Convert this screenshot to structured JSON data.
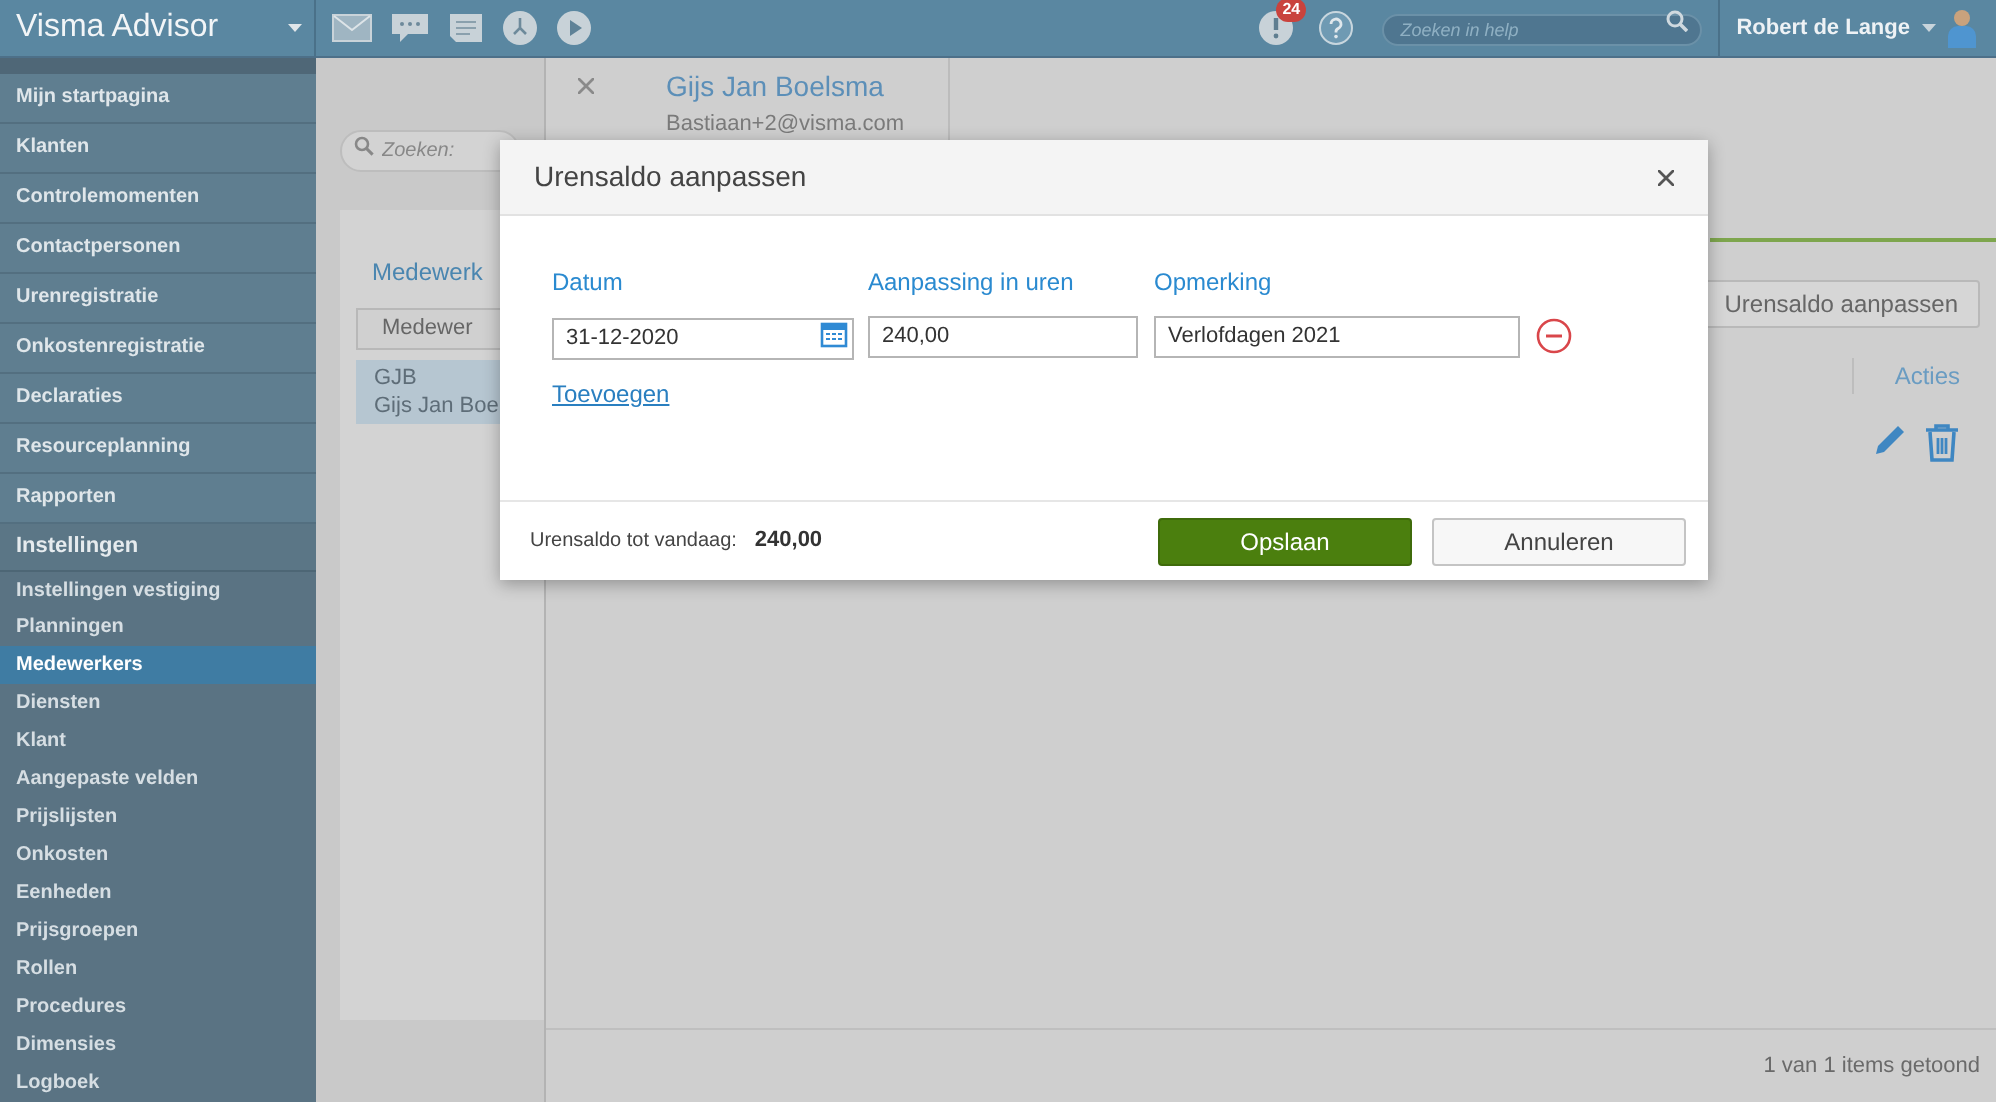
{
  "app": {
    "title": "Visma Advisor"
  },
  "topbar": {
    "notification_count": "24",
    "help_search": {
      "placeholder": "Zoeken in help"
    },
    "user": "Robert de Lange"
  },
  "sidebar": {
    "items": [
      {
        "label": "Mijn startpagina",
        "kind": "main",
        "selected": false
      },
      {
        "label": "Klanten",
        "kind": "main",
        "selected": false
      },
      {
        "label": "Controlemomenten",
        "kind": "main",
        "selected": false
      },
      {
        "label": "Contactpersonen",
        "kind": "main",
        "selected": false
      },
      {
        "label": "Urenregistratie",
        "kind": "main",
        "selected": false
      },
      {
        "label": "Onkostenregistratie",
        "kind": "main",
        "selected": false
      },
      {
        "label": "Declaraties",
        "kind": "main",
        "selected": false
      },
      {
        "label": "Resourceplanning",
        "kind": "main",
        "selected": false
      },
      {
        "label": "Rapporten",
        "kind": "main",
        "selected": false
      },
      {
        "label": "Instellingen",
        "kind": "section",
        "selected": false
      },
      {
        "label": "Instellingen vestiging",
        "kind": "sub",
        "selected": false
      },
      {
        "label": "Planningen",
        "kind": "sub",
        "selected": false
      },
      {
        "label": "Medewerkers",
        "kind": "sub",
        "selected": true
      },
      {
        "label": "Diensten",
        "kind": "sub",
        "selected": false
      },
      {
        "label": "Klant",
        "kind": "sub",
        "selected": false
      },
      {
        "label": "Aangepaste velden",
        "kind": "sub",
        "selected": false
      },
      {
        "label": "Prijslijsten",
        "kind": "sub",
        "selected": false
      },
      {
        "label": "Onkosten",
        "kind": "sub",
        "selected": false
      },
      {
        "label": "Eenheden",
        "kind": "sub",
        "selected": false
      },
      {
        "label": "Prijsgroepen",
        "kind": "sub",
        "selected": false
      },
      {
        "label": "Rollen",
        "kind": "sub",
        "selected": false
      },
      {
        "label": "Procedures",
        "kind": "sub",
        "selected": false
      },
      {
        "label": "Dimensies",
        "kind": "sub",
        "selected": false
      },
      {
        "label": "Logboek",
        "kind": "sub",
        "selected": false
      }
    ]
  },
  "list_panel": {
    "search": {
      "placeholder": "Zoeken:"
    },
    "title": "Medewerk",
    "column_button": "Medewer",
    "rows": [
      {
        "lines": [
          "GJB",
          "Gijs Jan Boe"
        ],
        "selected": true
      }
    ]
  },
  "detail": {
    "name": "Gijs Jan Boelsma",
    "email": "Bastiaan+2@visma.com",
    "button": "Urensaldo aanpassen",
    "actions_header": "Acties",
    "footer": "1 van 1 items getoond"
  },
  "dialog": {
    "title": "Urensaldo aanpassen",
    "columns": [
      "Datum",
      "Aanpassing in uren",
      "Opmerking"
    ],
    "rows": [
      {
        "date": "31-12-2020",
        "hours": "240,00",
        "remark": "Verlofdagen 2021"
      }
    ],
    "add_link": "Toevoegen",
    "balance_label": "Urensaldo tot vandaag:",
    "balance_value": "240,00",
    "buttons": [
      {
        "label": "Opslaan",
        "kind": "primary"
      },
      {
        "label": "Annuleren",
        "kind": "secondary"
      }
    ]
  }
}
